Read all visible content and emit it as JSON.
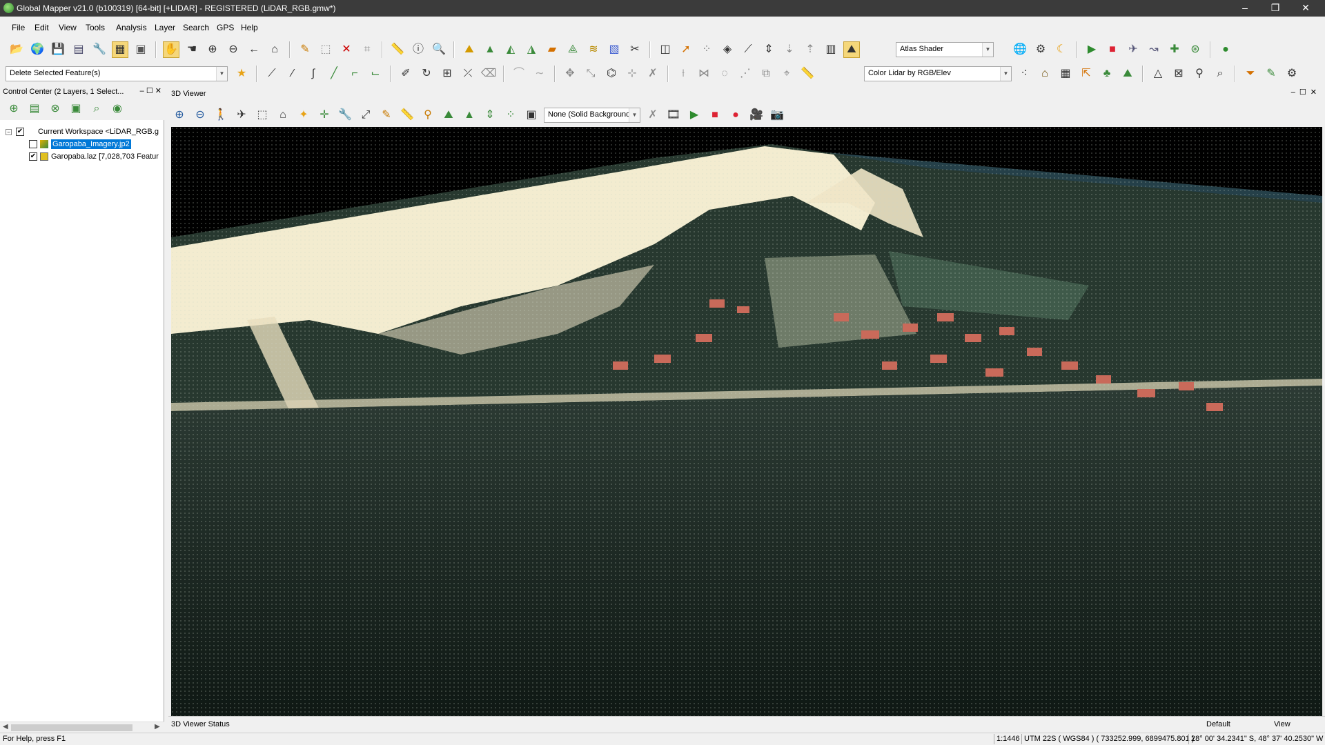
{
  "window": {
    "title": "Global Mapper v21.0 (b100319) [64-bit] [+LIDAR] - REGISTERED (LiDAR_RGB.gmw*)"
  },
  "menu": [
    "File",
    "Edit",
    "View",
    "Tools",
    "Analysis",
    "Layer",
    "Search",
    "GPS",
    "Help"
  ],
  "toolbar": {
    "shader": "Atlas Shader",
    "digitizer_action": "Delete Selected Feature(s)",
    "lidar_color": "Color Lidar by RGB/Elev"
  },
  "control_center": {
    "title": "Control Center (2 Layers, 1 Select...",
    "workspace": "Current Workspace <LiDAR_RGB.g",
    "layers": [
      {
        "name": "Garopaba_Imagery.jp2",
        "checked": false,
        "selected": true
      },
      {
        "name": "Garopaba.laz [7,028,703 Featur",
        "checked": true,
        "selected": false
      }
    ]
  },
  "viewer": {
    "title": "3D Viewer",
    "background": "None (Solid Background",
    "status_label": "3D Viewer Status",
    "status_default": "Default",
    "status_view": "View"
  },
  "statusbar": {
    "help": "For Help, press F1",
    "scale": "1:1446",
    "projection": "UTM 22S ( WGS84 ) ( 733252.999, 6899475.801 )",
    "latlon": "28° 00' 34.2341\" S, 48° 37' 40.2530\" W"
  },
  "colors": {
    "selection": "#0078d7",
    "titlebar": "#3b3b3b",
    "sand": "#f3ecd0",
    "vegetation": "#24382f"
  }
}
